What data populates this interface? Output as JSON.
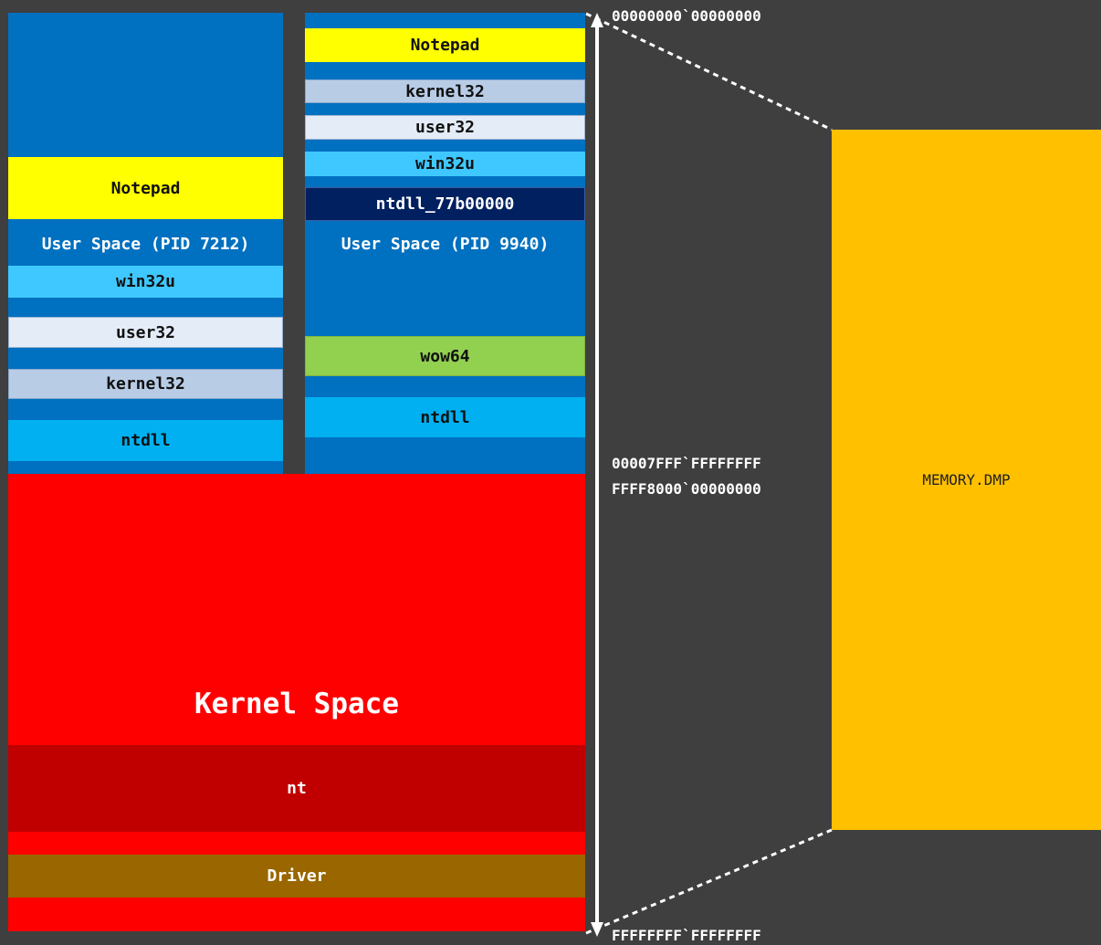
{
  "process1": {
    "label": "User Space (PID 7212)",
    "modules": {
      "notepad": "Notepad",
      "win32u": "win32u",
      "user32": "user32",
      "kernel32": "kernel32",
      "ntdll": "ntdll"
    }
  },
  "process2": {
    "label": "User Space (PID 9940)",
    "modules": {
      "notepad": "Notepad",
      "kernel32": "kernel32",
      "user32": "user32",
      "win32u": "win32u",
      "ntdll_wow": "ntdll_77b00000",
      "wow64": "wow64",
      "ntdll": "ntdll"
    }
  },
  "kernel": {
    "label": "Kernel Space",
    "modules": {
      "nt": "nt",
      "driver": "Driver"
    }
  },
  "addresses": {
    "start": "00000000`00000000",
    "user_end": "00007FFF`FFFFFFFF",
    "kernel_start": "FFFF8000`00000000",
    "end": "FFFFFFFF`FFFFFFFF"
  },
  "dump": {
    "label": "MEMORY.DMP"
  },
  "colors": {
    "background": "#3f3f3f",
    "user_space": "#0070c0",
    "kernel_space": "#ff0000",
    "notepad": "#ffff00",
    "win32u": "#3fc8ff",
    "user32": "#e4ecf7",
    "kernel32": "#b8cce6",
    "ntdll": "#00b0f0",
    "ntdll_wow": "#002060",
    "wow64": "#92d050",
    "nt": "#c00000",
    "driver": "#996600",
    "dump": "#ffc000"
  }
}
